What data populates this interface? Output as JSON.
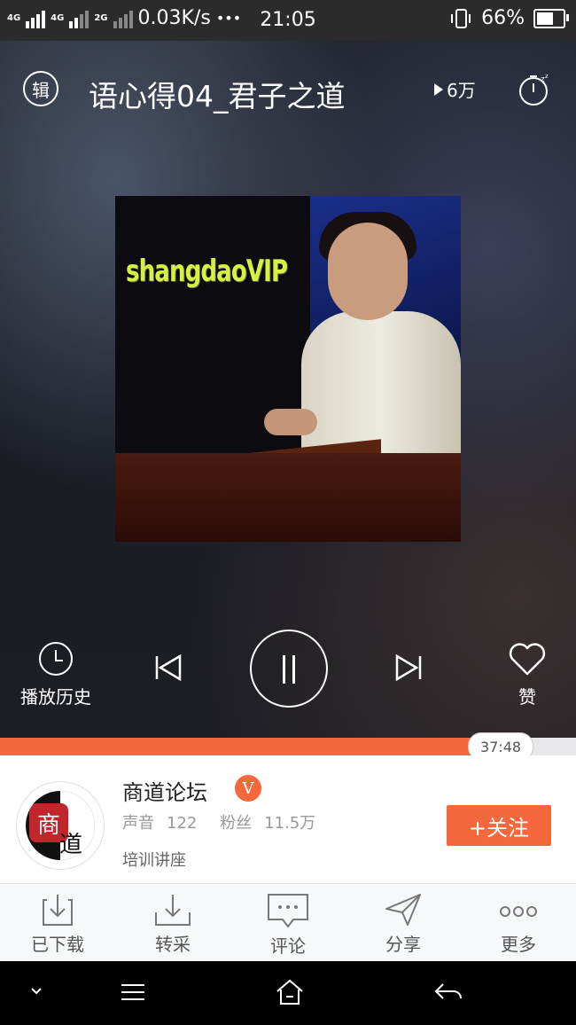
{
  "status": {
    "net1": "4G",
    "net2": "4G",
    "net3": "2G",
    "speed": "0.03K/s",
    "more": "•••",
    "time": "21:05",
    "battery": "66%"
  },
  "player": {
    "album_label": "辑",
    "title": "语心得04_君子之道",
    "plays": "6万",
    "cover_watermark": "shangdaoVIP",
    "history_label": "播放历史",
    "like_label": "赞",
    "progress_fraction": 0.826,
    "current_time": "37:48"
  },
  "author": {
    "name": "商道论坛",
    "verified": "V",
    "sounds_label": "声音",
    "sounds": "122",
    "fans_label": "粉丝",
    "fans": "11.5万",
    "tag": "培训讲座",
    "follow_label": "+关注",
    "avatar_chars": [
      "商",
      "道"
    ]
  },
  "actions": [
    {
      "label": "已下载",
      "icon": "downloaded-icon"
    },
    {
      "label": "转采",
      "icon": "collect-icon"
    },
    {
      "label": "评论",
      "icon": "comment-icon"
    },
    {
      "label": "分享",
      "icon": "share-icon"
    },
    {
      "label": "更多",
      "icon": "more-icon"
    }
  ],
  "colors": {
    "accent": "#f5673d"
  }
}
